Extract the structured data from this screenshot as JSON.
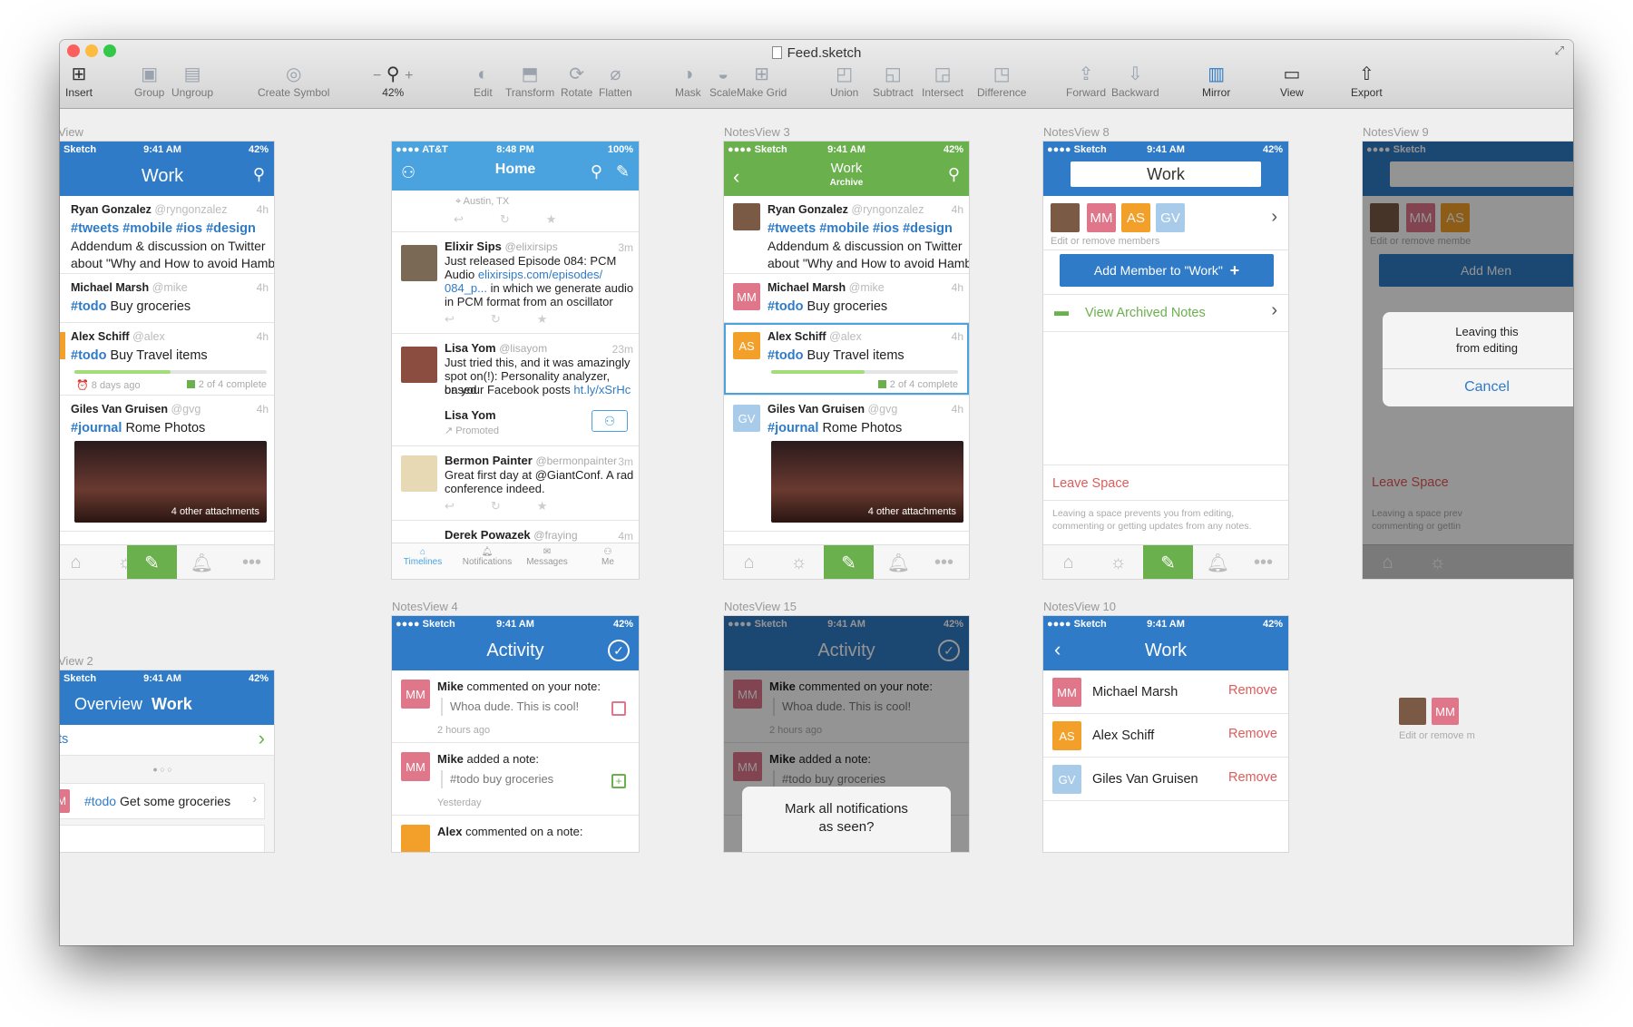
{
  "window": {
    "title": "Feed.sketch",
    "traffic": {
      "close": "#fc605c",
      "min": "#fdbc40",
      "zoom": "#34c84a"
    }
  },
  "toolbar": {
    "insert": "Insert",
    "group": "Group",
    "ungroup": "Ungroup",
    "create_symbol": "Create Symbol",
    "zoom_minus": "−",
    "zoom_plus": "+",
    "zoom_value": "42%",
    "edit": "Edit",
    "transform": "Transform",
    "rotate": "Rotate",
    "flatten": "Flatten",
    "mask": "Mask",
    "scale": "Scale",
    "make_grid": "Make Grid",
    "union": "Union",
    "subtract": "Subtract",
    "intersect": "Intersect",
    "difference": "Difference",
    "forward": "Forward",
    "backward": "Backward",
    "mirror": "Mirror",
    "view": "View",
    "export": "Export"
  },
  "artboards": {
    "a1": {
      "label": "View",
      "status": {
        "carrier": "Sketch",
        "time": "9:41 AM",
        "battery": "42%"
      },
      "title": "Work",
      "rows": [
        {
          "name": "Ryan Gonzalez",
          "handle": "@ryngonzalez",
          "time": "4h",
          "tags": "#tweets #mobile #ios #design",
          "line1": "Addendum & discussion on Twitter",
          "line2": "about \"Why and How to avoid Hamb…"
        },
        {
          "name": "Michael Marsh",
          "handle": "@mike",
          "time": "4h",
          "tag": "#todo",
          "text": "Buy groceries"
        },
        {
          "name": "Alex Schiff",
          "handle": "@alex",
          "time": "4h",
          "tag": "#todo",
          "text": "Buy Travel items",
          "progress": 0.5,
          "meta_left": "8 days ago",
          "meta_right": "2 of 4 complete"
        },
        {
          "name": "Giles Van Gruisen",
          "handle": "@gvg",
          "time": "4h",
          "tag": "#journal",
          "text": "Rome Photos",
          "photo_caption": "4 other attachments"
        }
      ]
    },
    "a2": {
      "status": {
        "carrier": "AT&T",
        "time": "8:48 PM",
        "battery": "100%"
      },
      "title": "Home",
      "loc": "Austin, TX",
      "tweets": [
        {
          "name": "Elixir Sips",
          "handle": "@elixirsips",
          "time": "3m",
          "l1": "Just released Episode 084: PCM",
          "l2a": "Audio ",
          "l2b": "elixirsips.com/episodes/",
          "l3a": "084_p...",
          "l3b": " in which we generate audio",
          "l4": "in PCM format from an oscillator",
          "rt": "1"
        },
        {
          "name": "Lisa Yom",
          "handle": "@lisayom",
          "time": "23m",
          "l1": "Just tried this, and it was amazingly",
          "l2": "spot on(!): Personality analyzer, based",
          "l3a": "on your Facebook posts ",
          "l3b": "ht.ly/xSrHc",
          "promo_name": "Lisa Yom",
          "promo": "Promoted"
        },
        {
          "name": "Bermon Painter",
          "handle": "@bermonpainter",
          "time": "3m",
          "l1": "Great first day at @GiantConf. A rad",
          "l2": "conference indeed."
        },
        {
          "name": "Derek Powazek",
          "handle": "@fraying",
          "time": "4m"
        }
      ],
      "tabs": [
        "Timelines",
        "Notifications",
        "Messages",
        "Me"
      ]
    },
    "a3": {
      "label": "NotesView 3",
      "status": {
        "carrier": "Sketch",
        "time": "9:41 AM",
        "battery": "42%"
      },
      "title": "Work",
      "subtitle": "Archive",
      "rows": [
        {
          "name": "Ryan Gonzalez",
          "handle": "@ryngonzalez",
          "time": "4h",
          "tags": "#tweets #mobile #ios #design",
          "line1": "Addendum & discussion on Twitter",
          "line2": "about \"Why and How to avoid Hamb…"
        },
        {
          "name": "Michael Marsh",
          "handle": "@mike",
          "time": "4h",
          "av": "MM",
          "tag": "#todo",
          "text": "Buy groceries"
        },
        {
          "name": "Alex Schiff",
          "handle": "@alex",
          "time": "4h",
          "av": "AS",
          "tag": "#todo",
          "text": "Buy Travel items",
          "progress": 0.5,
          "meta_right": "2 of 4 complete"
        },
        {
          "name": "Giles Van Gruisen",
          "handle": "@gvg",
          "time": "4h",
          "av": "GV",
          "tag": "#journal",
          "text": "Rome Photos",
          "photo_caption": "4 other attachments"
        }
      ]
    },
    "a4": {
      "label": "NotesView 8",
      "status": {
        "carrier": "Sketch",
        "time": "9:41 AM",
        "battery": "42%"
      },
      "title": "Work",
      "members": [
        "MM",
        "AS",
        "GV"
      ],
      "members_caption": "Edit or remove members",
      "add_btn": "Add Member to \"Work\"",
      "archived": "View Archived Notes",
      "leave": "Leave Space",
      "leave_note1": "Leaving a space prevents you from editing,",
      "leave_note2": "commenting or getting updates from any notes."
    },
    "a5": {
      "label": "NotesView 9",
      "status": {
        "carrier": "Sketch"
      },
      "members_caption": "Edit or remove membe",
      "add_btn": "Add Men",
      "alert1": "Leaving this",
      "alert2": "from editing",
      "cancel": "Cancel",
      "leave": "Leave Space",
      "leave_note1": "Leaving a space prev",
      "leave_note2": "commenting or gettin"
    },
    "a6": {
      "label": "NotesView 4",
      "status": {
        "carrier": "Sketch",
        "time": "9:41 AM",
        "battery": "42%"
      },
      "title": "Activity",
      "items": [
        {
          "av": "MM",
          "who": "Mike",
          "action": " commented on your note:",
          "quote": "Whoa dude. This is cool!",
          "time": "2 hours ago"
        },
        {
          "av": "MM",
          "who": "Mike",
          "action": " added a note:",
          "quote": "#todo buy groceries",
          "time": "Yesterday"
        },
        {
          "av": "",
          "who": "Alex",
          "action": " commented on a note:"
        }
      ]
    },
    "a7": {
      "label": "NotesView 15",
      "title": "Activity",
      "sheet1": "Mark all notifications",
      "sheet2": "as seen?"
    },
    "a8": {
      "label": "NotesView 10",
      "status": {
        "carrier": "Sketch",
        "time": "9:41 AM",
        "battery": "42%"
      },
      "title": "Work",
      "members": [
        {
          "av": "MM",
          "name": "Michael Marsh"
        },
        {
          "av": "AS",
          "name": "Alex Schiff"
        },
        {
          "av": "GV",
          "name": "Giles Van Gruisen"
        }
      ],
      "remove": "Remove"
    },
    "a9": {
      "label": "View 2",
      "status": {
        "carrier": "Sketch",
        "time": "9:41 AM",
        "battery": "42%"
      },
      "title_a": "Overview",
      "title_b": "Work",
      "row1": "ts",
      "todo_tag": "#todo",
      "todo_text": "Get some groceries",
      "todo_av": "MM"
    },
    "a10": {
      "caption": "Edit or remove m",
      "av": "MM"
    }
  }
}
